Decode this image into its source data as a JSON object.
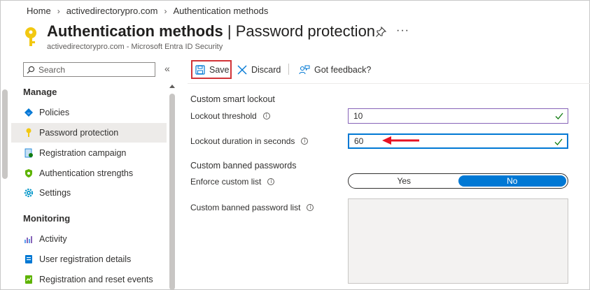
{
  "breadcrumb": {
    "items": [
      "Home",
      "activedirectorypro.com",
      "Authentication methods"
    ]
  },
  "header": {
    "title_bold": "Authentication methods",
    "title_rest": " | Password protection",
    "subtitle": "activedirectorypro.com - Microsoft Entra ID Security"
  },
  "sidebar": {
    "search_placeholder": "Search",
    "sections": [
      {
        "label": "Manage"
      },
      {
        "label": "Monitoring"
      }
    ],
    "items": [
      {
        "label": "Policies",
        "icon": "policies-icon"
      },
      {
        "label": "Password protection",
        "icon": "key-icon",
        "active": true
      },
      {
        "label": "Registration campaign",
        "icon": "registration-campaign-icon"
      },
      {
        "label": "Authentication strengths",
        "icon": "shield-icon"
      },
      {
        "label": "Settings",
        "icon": "gear-icon"
      },
      {
        "label": "Activity",
        "icon": "activity-chart-icon"
      },
      {
        "label": "User registration details",
        "icon": "user-details-icon"
      },
      {
        "label": "Registration and reset events",
        "icon": "events-icon"
      }
    ]
  },
  "toolbar": {
    "save_label": "Save",
    "discard_label": "Discard",
    "feedback_label": "Got feedback?"
  },
  "form": {
    "smart_lockout_heading": "Custom smart lockout",
    "lockout_threshold_label": "Lockout threshold",
    "lockout_threshold_value": "10",
    "lockout_duration_label": "Lockout duration in seconds",
    "lockout_duration_value": "60",
    "banned_heading": "Custom banned passwords",
    "enforce_label": "Enforce custom list",
    "enforce_options": [
      "Yes",
      "No"
    ],
    "enforce_selected": "No",
    "banned_list_label": "Custom banned password list",
    "banned_list_value": ""
  },
  "colors": {
    "accent": "#0078d4",
    "highlight_border": "#d13438",
    "valid_check": "#107c10",
    "key_yellow": "#f2c811"
  }
}
